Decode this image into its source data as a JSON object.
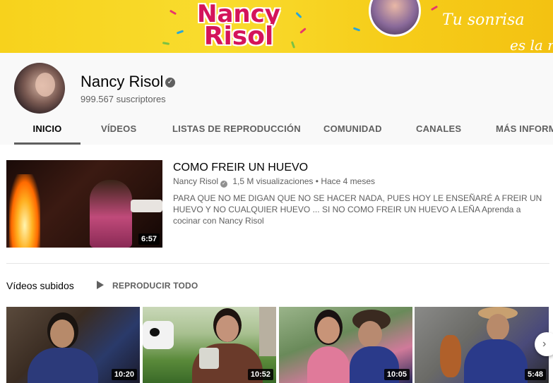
{
  "banner": {
    "title_line1": "Nancy",
    "title_line2": "Risol",
    "slogan_line1": "Tu sonrisa",
    "slogan_line2": "es la r"
  },
  "channel": {
    "name": "Nancy Risol",
    "subscribers": "999.567 suscriptores",
    "verified_icon": "check-icon"
  },
  "tabs": [
    {
      "label": "INICIO",
      "active": true
    },
    {
      "label": "VÍDEOS",
      "active": false
    },
    {
      "label": "LISTAS DE REPRODUCCIÓN",
      "active": false
    },
    {
      "label": "COMUNIDAD",
      "active": false
    },
    {
      "label": "CANALES",
      "active": false
    },
    {
      "label": "MÁS INFORMACIÓN",
      "active": false
    }
  ],
  "featured": {
    "title": "COMO FREIR UN HUEVO",
    "channel": "Nancy Risol",
    "views": "1,5 M visualizaciones",
    "separator": "•",
    "age": "Hace 4 meses",
    "description": "PARA QUE NO ME DIGAN QUE NO SE HACER NADA, PUES HOY LE ENSEÑARÉ A FREIR UN HUEVO Y NO CUALQUIER HUEVO ... SI NO COMO FREIR UN HUEVO A LEÑA Aprenda a cocinar con Nancy Risol",
    "duration": "6:57"
  },
  "shelf": {
    "title": "Vídeos subidos",
    "play_all": "REPRODUCIR TODO",
    "videos": [
      {
        "duration": "10:20"
      },
      {
        "duration": "10:52"
      },
      {
        "duration": "10:05"
      },
      {
        "duration": "5:48"
      }
    ]
  },
  "colors": {
    "banner_yellow": "#f7d21c",
    "banner_pink": "#d4145a",
    "text_primary": "#030303",
    "text_secondary": "#606060"
  }
}
